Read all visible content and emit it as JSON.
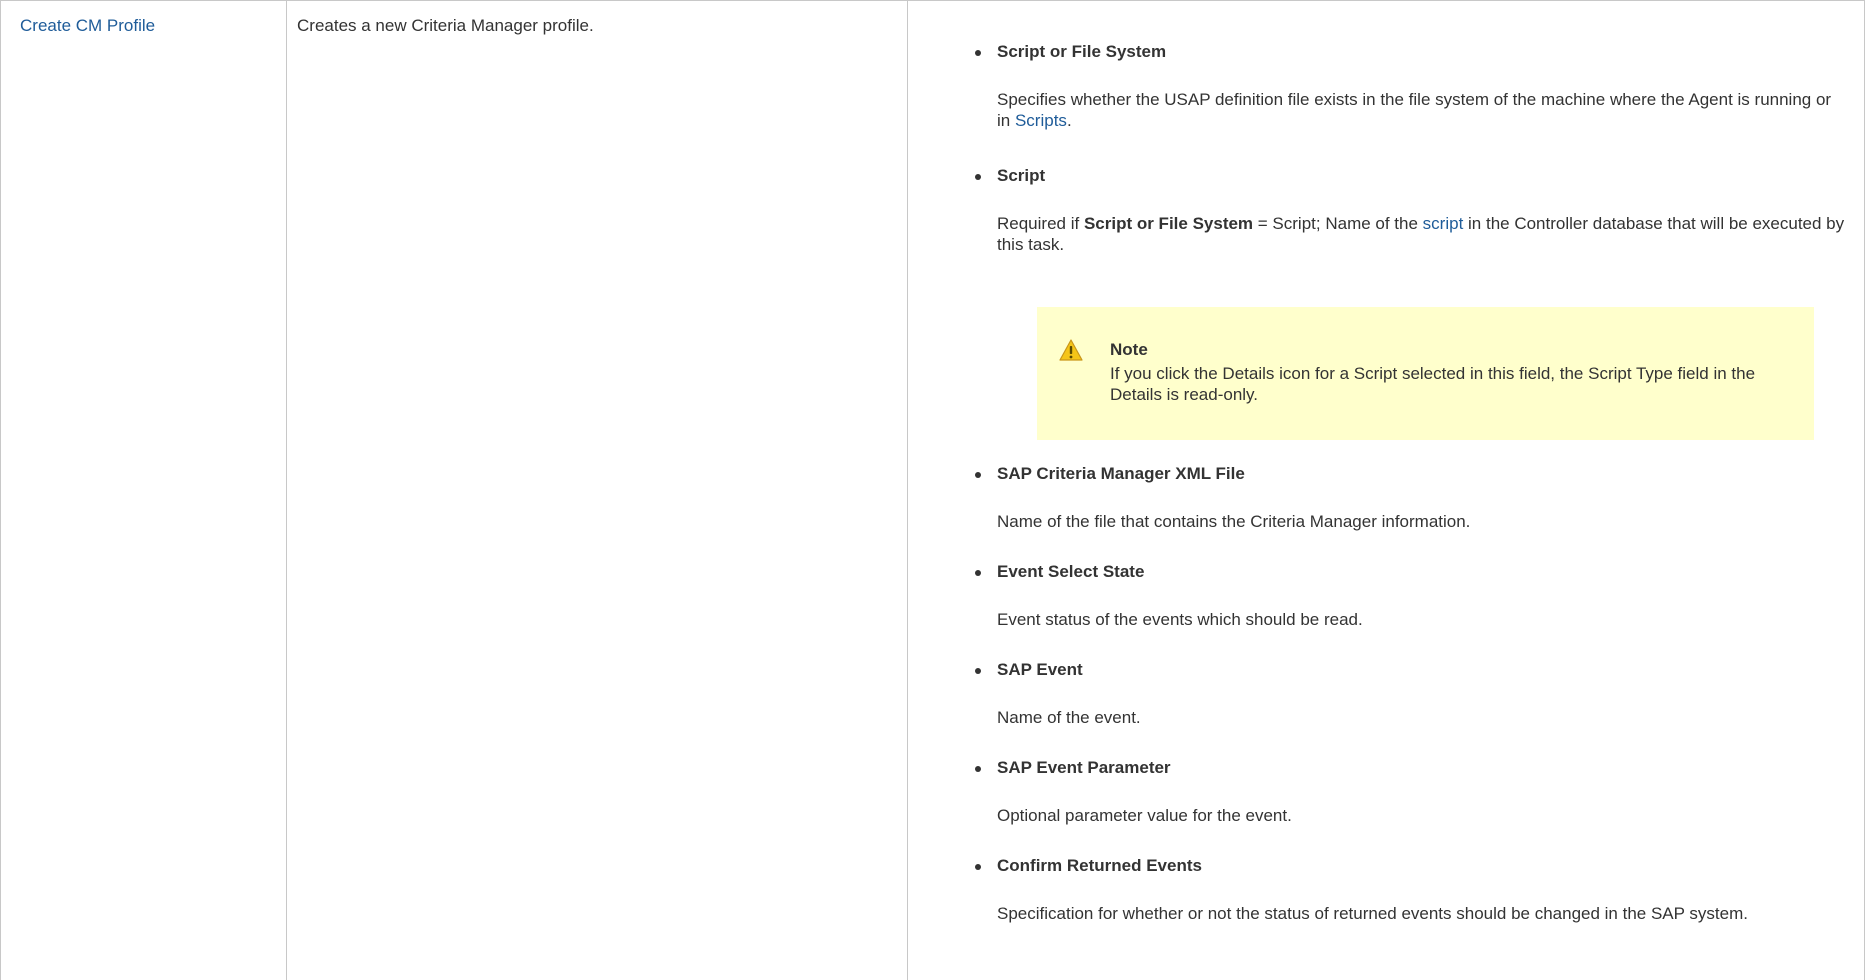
{
  "row": {
    "name_link": "Create CM Profile",
    "description": "Creates a new Criteria Manager profile."
  },
  "params": {
    "script_or_fs": {
      "title": "Script or File System",
      "desc_a": "Specifies whether the USAP definition file exists in the file system of the machine where the Agent is running or in ",
      "desc_link": "Scripts",
      "desc_b": "."
    },
    "script": {
      "title": "Script",
      "desc_a": "Required if ",
      "desc_bold": "Script or File System",
      "desc_b": " = Script; Name of the ",
      "desc_link": "script",
      "desc_c": " in the Controller database that will be executed by this task."
    },
    "xml_file": {
      "title": "SAP Criteria Manager XML File",
      "desc": "Name of the file that contains the Criteria Manager information."
    },
    "event_select_state": {
      "title": "Event Select State",
      "desc": "Event status of the events which should be read."
    },
    "sap_event": {
      "title": "SAP Event",
      "desc": "Name of the event."
    },
    "sap_event_parameter": {
      "title": "SAP Event Parameter",
      "desc": "Optional parameter value for the event."
    },
    "confirm_returned_events": {
      "title": "Confirm Returned Events",
      "desc": "Specification for whether or not the status of returned events should be changed in the SAP system."
    }
  },
  "note": {
    "icon": "warning-icon",
    "title": "Note",
    "body": "If you click the Details icon for a Script selected in this field, the Script Type field in the Details is read-only."
  },
  "colors": {
    "link": "#1f5c99",
    "note_bg": "#ffffcc",
    "border": "#c8c8c8",
    "text": "#333333"
  }
}
